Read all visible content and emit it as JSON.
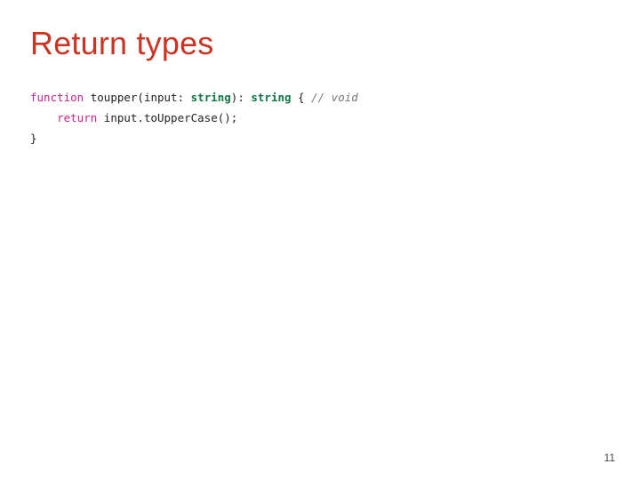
{
  "title": "Return types",
  "code": {
    "l1": {
      "kw": "function",
      "mid": " toupper(input: ",
      "t1": "string",
      "post1": "): ",
      "t2": "string",
      "post2": " { ",
      "cm": "// void"
    },
    "l2": {
      "indent": "    ",
      "kw": "return",
      "rest": " input.toUpperCase();"
    },
    "l3": "}"
  },
  "page": "11"
}
